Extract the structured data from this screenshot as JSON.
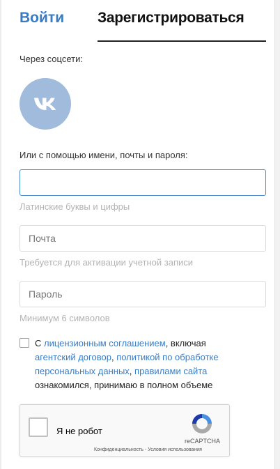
{
  "tabs": {
    "login": "Войти",
    "register": "Зарегистрироваться"
  },
  "social": {
    "label": "Через соцсети:",
    "vk_icon": "vk-logo-icon"
  },
  "form": {
    "label": "Или с помощью имени, почты и пароля:",
    "name": {
      "value": "",
      "placeholder": "",
      "hint": "Латинские буквы и цифры"
    },
    "email": {
      "value": "",
      "placeholder": "Почта",
      "hint": "Требуется для активации учетной записи"
    },
    "password": {
      "value": "",
      "placeholder": "Пароль",
      "hint": "Минимум 6 символов"
    }
  },
  "agreement": {
    "prefix": "С ",
    "license_link": "лицензионным соглашением",
    "text1": ", включая ",
    "agency_link": "агентский договор",
    "sep1": ", ",
    "privacy_link": "политикой по обработке персональных данных",
    "sep2": ", ",
    "rules_link": "правилами сайта",
    "suffix": " ознакомился, принимаю в полном объеме",
    "checked": false
  },
  "recaptcha": {
    "label": "Я не робот",
    "brand": "reCAPTCHA",
    "privacy": "Конфиденциальность",
    "separator": " - ",
    "terms": "Условия использования"
  },
  "colors": {
    "accent": "#3a7cc4",
    "vk": "#a0bbdc",
    "focus_border": "#4a8bd0",
    "hint": "#b3b3b3"
  }
}
